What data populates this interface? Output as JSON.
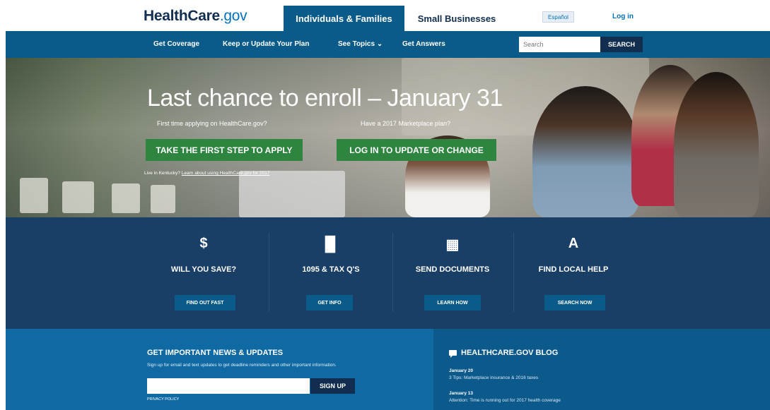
{
  "header": {
    "logo_main": "HealthCare",
    "logo_suffix": ".gov",
    "tab_individuals": "Individuals & Families",
    "tab_small_business": "Small Businesses",
    "espanol": "Español",
    "login": "Log in"
  },
  "nav": {
    "items": [
      "Get Coverage",
      "Keep or Update Your Plan",
      "See Topics",
      "Get Answers"
    ],
    "see_topics_caret": "⌄",
    "search_placeholder": "Search",
    "search_button": "SEARCH"
  },
  "hero": {
    "title": "Last chance to enroll – January 31",
    "sub_left": "First time applying on HealthCare.gov?",
    "sub_right": "Have a 2017 Marketplace plan?",
    "btn_apply": "TAKE THE FIRST STEP TO APPLY",
    "btn_login": "LOG IN TO UPDATE OR CHANGE",
    "note_prefix": "Live in Kentucky? ",
    "note_link": "Learn about using HealthCare.gov for 2017"
  },
  "features": [
    {
      "icon": "$",
      "icon_name": "dollar-icon",
      "title": "WILL YOU SAVE?",
      "button": "FIND OUT FAST"
    },
    {
      "icon": "▉",
      "icon_name": "document-icon",
      "title": "1095 & TAX Q'S",
      "button": "GET INFO"
    },
    {
      "icon": "▦",
      "icon_name": "upload-document-icon",
      "title": "SEND DOCUMENTS",
      "button": "LEARN HOW"
    },
    {
      "icon": "A",
      "icon_name": "road-icon",
      "title": "FIND LOCAL HELP",
      "button": "SEARCH NOW"
    }
  ],
  "news": {
    "title": "GET IMPORTANT NEWS & UPDATES",
    "subtitle": "Sign up for email and text updates to get deadline reminders and other important information.",
    "signup": "SIGN UP",
    "privacy": "PRIVACY POLICY"
  },
  "blog": {
    "title": "HEALTHCARE.GOV BLOG",
    "posts": [
      {
        "date": "January 20",
        "text": "3 Tips: Marketplace insurance & 2016 taxes"
      },
      {
        "date": "January 13",
        "text": "Attention: Time is running out for 2017 health coverage"
      }
    ]
  },
  "colors": {
    "navy": "#112e51",
    "nav_blue": "#0b5b8a",
    "green": "#2e8540",
    "band": "#1a3f67"
  }
}
